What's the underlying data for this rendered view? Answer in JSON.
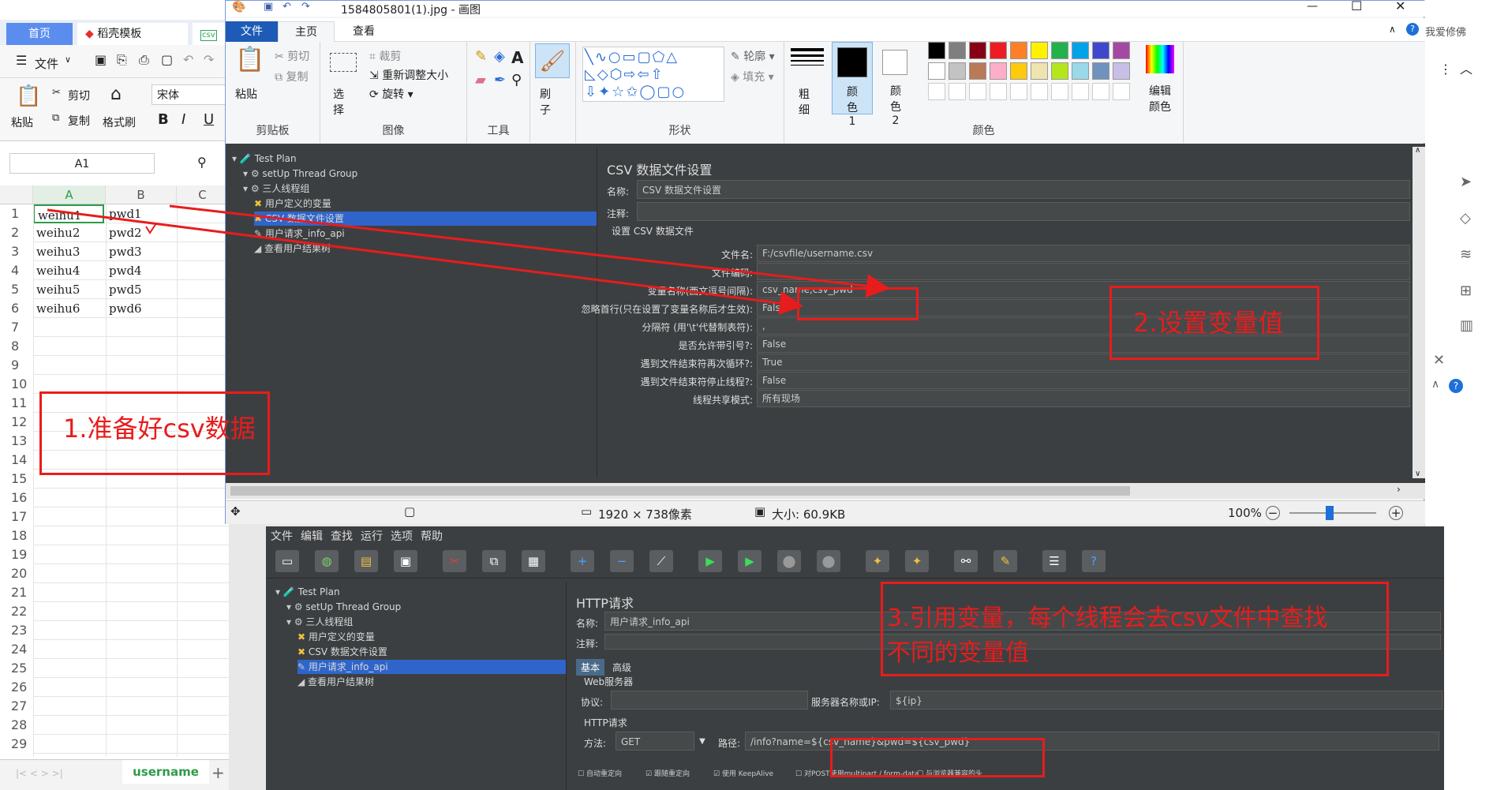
{
  "wps": {
    "tab_home": "首页",
    "tab_template": "稻壳模板",
    "tab_csv": "u",
    "menu_file": "文件",
    "ribbon": {
      "paste": "粘贴",
      "cut": "剪切",
      "copy": "复制",
      "format_painter": "格式刷",
      "font": "宋体",
      "bold": "B",
      "italic": "I",
      "underline": "U"
    },
    "cell_ref": "A1",
    "columns": [
      "A",
      "B",
      "C"
    ],
    "rows": [
      "1",
      "2",
      "3",
      "4",
      "5",
      "6",
      "7",
      "8",
      "9",
      "10",
      "11",
      "12",
      "13",
      "14",
      "15",
      "16",
      "17",
      "18",
      "19",
      "20",
      "21",
      "22",
      "23",
      "24",
      "25",
      "26",
      "27",
      "28",
      "29"
    ],
    "data": [
      [
        "weihu1",
        "pwd1"
      ],
      [
        "weihu2",
        "pwd2"
      ],
      [
        "weihu3",
        "pwd3"
      ],
      [
        "weihu4",
        "pwd4"
      ],
      [
        "weihu5",
        "pwd5"
      ],
      [
        "weihu6",
        "pwd6"
      ]
    ],
    "sheet_tab": "username",
    "add_sheet": "+"
  },
  "paint": {
    "title": "1584805801(1).jpg - 画图",
    "tabs": [
      "文件",
      "主页",
      "查看"
    ],
    "clipboard": {
      "paste": "粘贴",
      "cut": "剪切",
      "copy": "复制",
      "label": "剪贴板"
    },
    "image": {
      "select": "选择",
      "crop": "裁剪",
      "resize": "重新调整大小",
      "rotate": "旋转",
      "label": "图像"
    },
    "tools_label": "工具",
    "brush": "刷子",
    "shapes": {
      "outline": "轮廓",
      "fill": "填充",
      "label": "形状"
    },
    "size": "粗细",
    "color1": "颜色 1",
    "color2": "颜色 2",
    "edit_colors": "编辑颜色",
    "colors_label": "颜色",
    "palette": [
      "#000000",
      "#7f7f7f",
      "#880015",
      "#ed1c24",
      "#ff7f27",
      "#fff200",
      "#22b14c",
      "#00a2e8",
      "#3f48cc",
      "#a349a4",
      "#ffffff",
      "#c3c3c3",
      "#b97a57",
      "#ffaec9",
      "#ffc90e",
      "#efe4b0",
      "#b5e61d",
      "#99d9ea",
      "#7092be",
      "#c8bfe7"
    ],
    "status": {
      "dimensions": "1920 × 738像素",
      "size": "大小: 60.9KB",
      "zoom": "100%"
    }
  },
  "jmeter_top": {
    "tree": [
      "Test Plan",
      "setUp Thread Group",
      "三人线程组",
      "用户定义的变量",
      "CSV 数据文件设置",
      "用户请求_info_api",
      "查看用户结果树"
    ],
    "panel_title": "CSV 数据文件设置",
    "name_label": "名称:",
    "name_value": "CSV 数据文件设置",
    "comment_label": "注释:",
    "section": "设置 CSV 数据文件",
    "fields": [
      {
        "label": "文件名:",
        "value": "F:/csvfile/username.csv"
      },
      {
        "label": "文件编码:",
        "value": ""
      },
      {
        "label": "变量名称(西文逗号间隔):",
        "value": "csv_name,csv_pwd"
      },
      {
        "label": "忽略首行(只在设置了变量名称后才生效):",
        "value": "False"
      },
      {
        "label": "分隔符 (用'\\t'代替制表符):",
        "value": ","
      },
      {
        "label": "是否允许带引号?:",
        "value": "False"
      },
      {
        "label": "遇到文件结束符再次循环?:",
        "value": "True"
      },
      {
        "label": "遇到文件结束符停止线程?:",
        "value": "False"
      },
      {
        "label": "线程共享模式:",
        "value": "所有现场"
      }
    ]
  },
  "jmeter_bottom": {
    "menu": [
      "文件",
      "编辑",
      "查找",
      "运行",
      "选项",
      "帮助"
    ],
    "tree": [
      "Test Plan",
      "setUp Thread Group",
      "三人线程组",
      "用户定义的变量",
      "CSV 数据文件设置",
      "用户请求_info_api",
      "查看用户结果树"
    ],
    "panel_title": "HTTP请求",
    "name_label": "名称:",
    "name_value": "用户请求_info_api",
    "comment_label": "注释:",
    "tab_basic": "基本",
    "tab_advanced": "高级",
    "web_server": "Web服务器",
    "protocol_label": "协议:",
    "server_label": "服务器名称或IP:",
    "server_value": "${ip}",
    "http_request": "HTTP请求",
    "method_label": "方法:",
    "method_value": "GET",
    "path_label": "路径:",
    "path_value": "/info?name=${csv_name}&pwd=${csv_pwd}",
    "checkboxes": [
      "自动重定向",
      "跟随重定向",
      "使用 KeepAlive",
      "对POST使用multipart / form-data",
      "与浏览器兼容的头"
    ]
  },
  "annotations": {
    "step1": "1.准备好csv数据",
    "step2": "2.设置变量值",
    "step3_line1": "3.引用变量，每个线程会去csv文件中查找",
    "step3_line2": "不同的变量值",
    "color": "#e81c1c"
  },
  "side": {
    "text": "我爱修佛"
  }
}
